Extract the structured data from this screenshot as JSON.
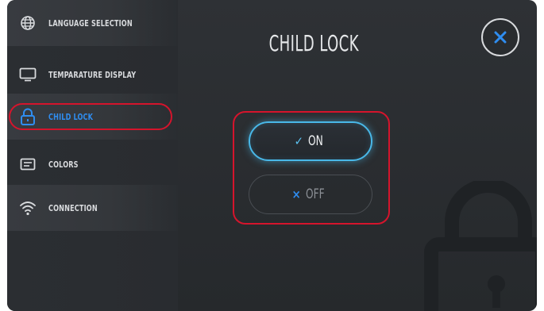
{
  "sidebar": {
    "items": [
      {
        "label": "LANGUAGE SELECTION",
        "icon": "globe-icon"
      },
      {
        "label": "TEMPARATURE DISPLAY",
        "icon": "monitor-icon"
      },
      {
        "label": "CHILD LOCK",
        "icon": "lock-icon",
        "active": true
      },
      {
        "label": "COLORS",
        "icon": "palette-icon"
      },
      {
        "label": "CONNECTION",
        "icon": "wifi-icon"
      }
    ]
  },
  "main": {
    "title": "CHILD LOCK",
    "close_icon": "close-icon",
    "options": [
      {
        "label": "ON",
        "mark": "✓",
        "selected": true
      },
      {
        "label": "OFF",
        "mark": "×",
        "selected": false
      }
    ]
  },
  "colors": {
    "accent": "#2f8df0",
    "glow": "#49b8e8",
    "highlight_outline": "#d5142c",
    "background": "#2b2e32"
  }
}
